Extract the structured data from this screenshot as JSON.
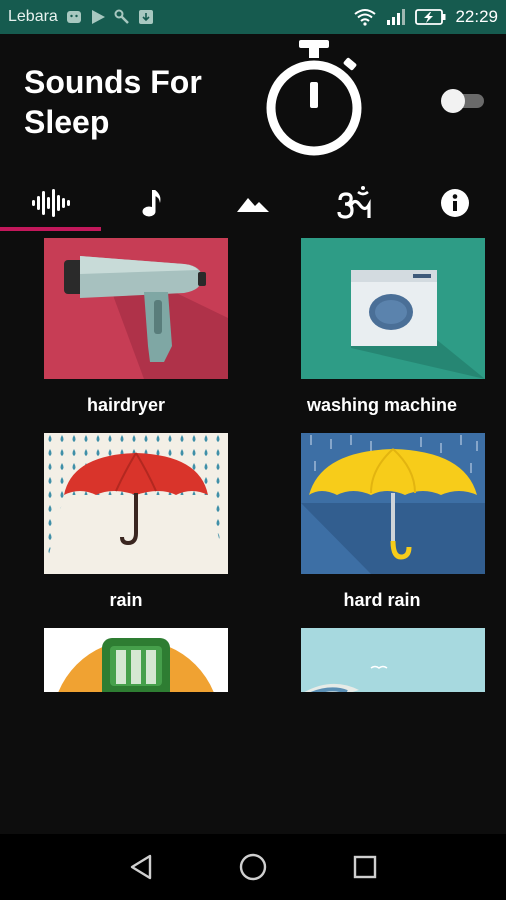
{
  "status_bar": {
    "carrier": "Lebara",
    "time": "22:29",
    "icons": [
      "android-icon",
      "play-store-icon",
      "wrench-icon",
      "download-icon",
      "wifi-icon",
      "signal-icon",
      "battery-charging-icon"
    ]
  },
  "header": {
    "title": "Sounds For Sleep",
    "timer_icon": "stopwatch-icon",
    "toggle_state": "off"
  },
  "tabs": [
    {
      "name": "waveform",
      "icon": "waveform-icon",
      "active": true
    },
    {
      "name": "music",
      "icon": "music-note-icon",
      "active": false
    },
    {
      "name": "nature",
      "icon": "mountain-icon",
      "active": false
    },
    {
      "name": "meditation",
      "icon": "om-icon",
      "active": false
    },
    {
      "name": "info",
      "icon": "info-icon",
      "active": false
    }
  ],
  "sounds": [
    {
      "label": "hairdryer",
      "image": "hairdryer-image"
    },
    {
      "label": "washing machine",
      "image": "washing-machine-image"
    },
    {
      "label": "rain",
      "image": "umbrella-rain-image"
    },
    {
      "label": "hard rain",
      "image": "umbrella-hard-rain-image"
    },
    {
      "label": "",
      "image": "train-image"
    },
    {
      "label": "",
      "image": "sea-image"
    }
  ],
  "nav": {
    "buttons": [
      "back-icon",
      "home-icon",
      "recents-icon"
    ]
  },
  "colors": {
    "status_bar": "#165b4f",
    "accent": "#c2185b",
    "background": "#0d0d0d"
  }
}
